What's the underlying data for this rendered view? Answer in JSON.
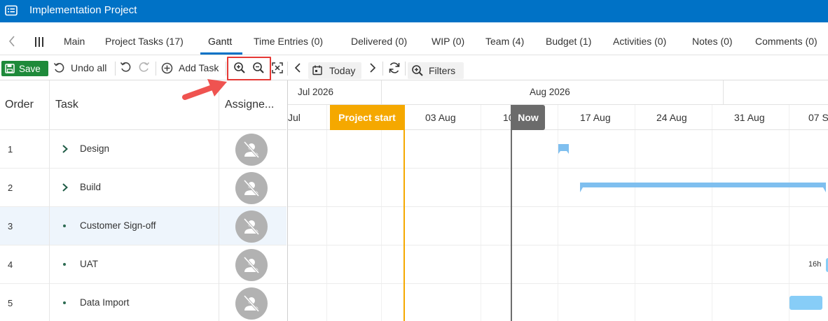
{
  "window": {
    "title": "Implementation Project"
  },
  "tabs": [
    {
      "label": "Main"
    },
    {
      "label": "Project Tasks (17)"
    },
    {
      "label": "Gantt"
    },
    {
      "label": "Time Entries (0)"
    },
    {
      "label": "Delivered (0)"
    },
    {
      "label": "WIP (0)"
    },
    {
      "label": "Team (4)"
    },
    {
      "label": "Budget (1)"
    },
    {
      "label": "Activities (0)"
    },
    {
      "label": "Notes (0)"
    },
    {
      "label": "Comments (0)"
    }
  ],
  "active_tab": "Gantt",
  "toolbar": {
    "save_label": "Save",
    "undo_all_label": "Undo all",
    "add_task_label": "Add Task",
    "today_label": "Today",
    "filters_label": "Filters"
  },
  "grid": {
    "columns": [
      "Order",
      "Task",
      "Assigne..."
    ],
    "rows": [
      {
        "order": "1",
        "name": "Design",
        "kind": "parent"
      },
      {
        "order": "2",
        "name": "Build",
        "kind": "parent"
      },
      {
        "order": "3",
        "name": "Customer Sign-off",
        "kind": "task",
        "selected": true
      },
      {
        "order": "4",
        "name": "UAT",
        "kind": "task"
      },
      {
        "order": "5",
        "name": "Data Import",
        "kind": "task"
      }
    ]
  },
  "gantt": {
    "months": [
      "Jul 2026",
      "Aug 2026"
    ],
    "weeks": [
      "Jul",
      "03 Aug",
      "10",
      "17 Aug",
      "24 Aug",
      "31 Aug",
      "07 S"
    ],
    "markers": {
      "start": "Project start",
      "now": "Now"
    },
    "uat_duration_label": "16h"
  },
  "colors": {
    "title_bar": "#0072c6",
    "save_button": "#1e8a3a",
    "project_start": "#f5a800",
    "now_marker": "#6b6b6b",
    "task_bar": "#87cdf7",
    "highlight": "#e53935"
  }
}
